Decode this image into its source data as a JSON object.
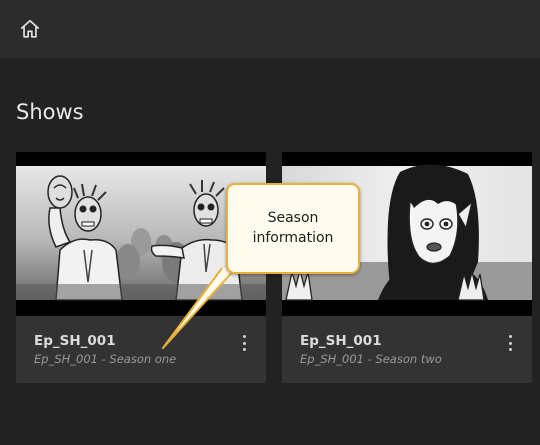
{
  "header": {
    "home_icon": "home-icon"
  },
  "page": {
    "title": "Shows"
  },
  "shows": [
    {
      "title": "Ep_SH_001",
      "subtitle": "Ep_SH_001 - Season one",
      "menu_icon": "more-vertical-icon"
    },
    {
      "title": "Ep_SH_001",
      "subtitle": "Ep_SH_001 - Season two",
      "menu_icon": "more-vertical-icon"
    }
  ],
  "callout": {
    "text": "Season information"
  },
  "colors": {
    "background": "#222222",
    "header": "#2c2c2c",
    "card": "#333333",
    "callout_border": "#e8b23a",
    "callout_fill": "#fffbee"
  }
}
